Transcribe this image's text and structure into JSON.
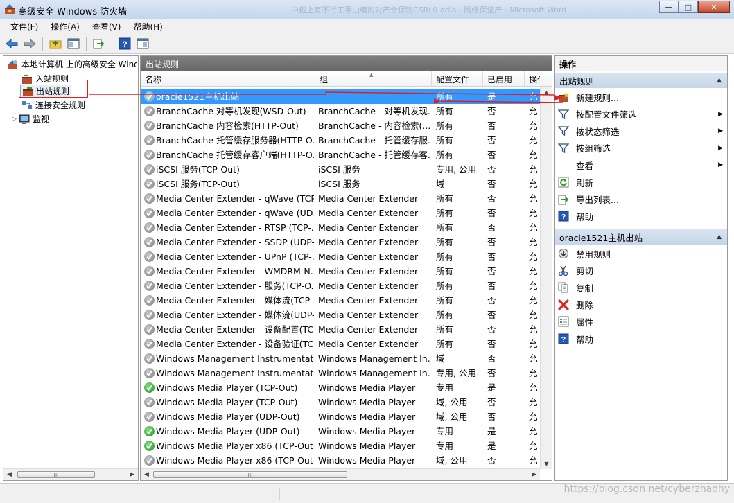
{
  "window": {
    "title": "高级安全 Windows 防火墙",
    "background_title": "中截上有不行工事由编的对产合保制CSRL0.adia - 网络保证产 - Microsoft Word",
    "minimize": "—",
    "maximize": "□",
    "close": "✕"
  },
  "menu": [
    "文件(F)",
    "操作(A)",
    "查看(V)",
    "帮助(H)"
  ],
  "toolbar_icons": [
    "back-icon",
    "forward-icon",
    "up-folder-icon",
    "show-hide-tree-icon",
    "export-icon",
    "help-icon",
    "show-action-pane-icon"
  ],
  "tree": {
    "root": "本地计算机 上的高级安全 Windows 防火墙",
    "items": [
      "入站规则",
      "出站规则",
      "连接安全规则",
      "监视"
    ],
    "selected": "出站规则",
    "scroll_thumb": "III"
  },
  "center": {
    "header": "出站规则",
    "columns": [
      "名称",
      "组",
      "配置文件",
      "已启用",
      "操作"
    ],
    "rows": [
      {
        "name": "oracle1521主机出站",
        "group": "",
        "profile": "所有",
        "enabled": "是",
        "action": "允",
        "icon": "gray",
        "selected": true
      },
      {
        "name": "BranchCache 对等机发现(WSD-Out)",
        "group": "BranchCache - 对等机发现...",
        "profile": "所有",
        "enabled": "否",
        "action": "允",
        "icon": "gray"
      },
      {
        "name": "BranchCache 内容检索(HTTP-Out)",
        "group": "BranchCache - 内容检索(...",
        "profile": "所有",
        "enabled": "否",
        "action": "允",
        "icon": "gray"
      },
      {
        "name": "BranchCache 托管缓存服务器(HTTP-O...",
        "group": "BranchCache - 托管缓存服...",
        "profile": "所有",
        "enabled": "否",
        "action": "允",
        "icon": "gray"
      },
      {
        "name": "BranchCache 托管缓存客户端(HTTP-O...",
        "group": "BranchCache - 托管缓存客...",
        "profile": "所有",
        "enabled": "否",
        "action": "允",
        "icon": "gray"
      },
      {
        "name": "iSCSI 服务(TCP-Out)",
        "group": "iSCSI 服务",
        "profile": "专用, 公用",
        "enabled": "否",
        "action": "允",
        "icon": "gray"
      },
      {
        "name": "iSCSI 服务(TCP-Out)",
        "group": "iSCSI 服务",
        "profile": "域",
        "enabled": "否",
        "action": "允",
        "icon": "gray"
      },
      {
        "name": "Media Center Extender - qWave (TCP...",
        "group": "Media Center Extender",
        "profile": "所有",
        "enabled": "否",
        "action": "允",
        "icon": "gray"
      },
      {
        "name": "Media Center Extender - qWave (UD...",
        "group": "Media Center Extender",
        "profile": "所有",
        "enabled": "否",
        "action": "允",
        "icon": "gray"
      },
      {
        "name": "Media Center Extender - RTSP (TCP-...",
        "group": "Media Center Extender",
        "profile": "所有",
        "enabled": "否",
        "action": "允",
        "icon": "gray"
      },
      {
        "name": "Media Center Extender - SSDP (UDP-...",
        "group": "Media Center Extender",
        "profile": "所有",
        "enabled": "否",
        "action": "允",
        "icon": "gray"
      },
      {
        "name": "Media Center Extender - UPnP (TCP-...",
        "group": "Media Center Extender",
        "profile": "所有",
        "enabled": "否",
        "action": "允",
        "icon": "gray"
      },
      {
        "name": "Media Center Extender - WMDRM-N...",
        "group": "Media Center Extender",
        "profile": "所有",
        "enabled": "否",
        "action": "允",
        "icon": "gray"
      },
      {
        "name": "Media Center Extender - 服务(TCP-O...",
        "group": "Media Center Extender",
        "profile": "所有",
        "enabled": "否",
        "action": "允",
        "icon": "gray"
      },
      {
        "name": "Media Center Extender - 媒体流(TCP-...",
        "group": "Media Center Extender",
        "profile": "所有",
        "enabled": "否",
        "action": "允",
        "icon": "gray"
      },
      {
        "name": "Media Center Extender - 媒体流(UDP-...",
        "group": "Media Center Extender",
        "profile": "所有",
        "enabled": "否",
        "action": "允",
        "icon": "gray"
      },
      {
        "name": "Media Center Extender - 设备配置(TC...",
        "group": "Media Center Extender",
        "profile": "所有",
        "enabled": "否",
        "action": "允",
        "icon": "gray"
      },
      {
        "name": "Media Center Extender - 设备验证(TC...",
        "group": "Media Center Extender",
        "profile": "所有",
        "enabled": "否",
        "action": "允",
        "icon": "gray"
      },
      {
        "name": "Windows Management Instrumentati...",
        "group": "Windows Management In...",
        "profile": "域",
        "enabled": "否",
        "action": "允",
        "icon": "gray"
      },
      {
        "name": "Windows Management Instrumentati...",
        "group": "Windows Management In...",
        "profile": "专用, 公用",
        "enabled": "否",
        "action": "允",
        "icon": "gray"
      },
      {
        "name": "Windows Media Player (TCP-Out)",
        "group": "Windows Media Player",
        "profile": "专用",
        "enabled": "是",
        "action": "允",
        "icon": "green"
      },
      {
        "name": "Windows Media Player (TCP-Out)",
        "group": "Windows Media Player",
        "profile": "域, 公用",
        "enabled": "否",
        "action": "允",
        "icon": "gray"
      },
      {
        "name": "Windows Media Player (UDP-Out)",
        "group": "Windows Media Player",
        "profile": "域, 公用",
        "enabled": "否",
        "action": "允",
        "icon": "gray"
      },
      {
        "name": "Windows Media Player (UDP-Out)",
        "group": "Windows Media Player",
        "profile": "专用",
        "enabled": "是",
        "action": "允",
        "icon": "green"
      },
      {
        "name": "Windows Media Player x86 (TCP-Out)",
        "group": "Windows Media Player",
        "profile": "专用",
        "enabled": "是",
        "action": "允",
        "icon": "green"
      },
      {
        "name": "Windows Media Player x86 (TCP-Out)",
        "group": "Windows Media Player",
        "profile": "域, 公用",
        "enabled": "否",
        "action": "允",
        "icon": "gray"
      }
    ],
    "scroll_thumb": "III"
  },
  "actions": {
    "title": "操作",
    "section1": {
      "header": "出站规则",
      "items": [
        {
          "label": "新建规则...",
          "icon": "new-rule-icon",
          "submenu": false
        },
        {
          "label": "按配置文件筛选",
          "icon": "filter-icon",
          "submenu": true
        },
        {
          "label": "按状态筛选",
          "icon": "filter-icon",
          "submenu": true
        },
        {
          "label": "按组筛选",
          "icon": "filter-icon",
          "submenu": true
        },
        {
          "label": "查看",
          "icon": "",
          "submenu": true
        },
        {
          "label": "刷新",
          "icon": "refresh-icon",
          "submenu": false
        },
        {
          "label": "导出列表...",
          "icon": "export-list-icon",
          "submenu": false
        },
        {
          "label": "帮助",
          "icon": "help-icon",
          "submenu": false
        }
      ]
    },
    "section2": {
      "header": "oracle1521主机出站",
      "items": [
        {
          "label": "禁用规则",
          "icon": "disable-rule-icon"
        },
        {
          "label": "剪切",
          "icon": "cut-icon"
        },
        {
          "label": "复制",
          "icon": "copy-icon"
        },
        {
          "label": "删除",
          "icon": "delete-icon"
        },
        {
          "label": "属性",
          "icon": "properties-icon"
        },
        {
          "label": "帮助",
          "icon": "help-icon"
        }
      ]
    }
  },
  "watermark": "https://blog.csdn.net/cyberzhaohy",
  "colors": {
    "selection": "#3399ff",
    "annotation": "#e02020",
    "header": "#6f6f6f"
  }
}
